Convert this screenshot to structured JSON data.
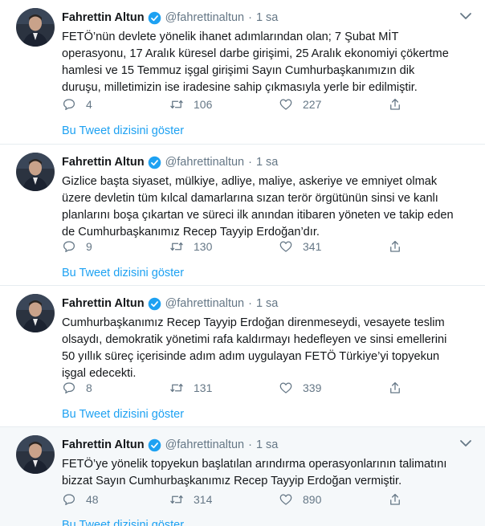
{
  "colors": {
    "accent": "#1da1f2",
    "secondary_text": "#657786",
    "divider": "#e6ecf0",
    "highlight_bg": "#f5f8fa"
  },
  "icons": [
    "verified-badge-icon",
    "chevron-down-icon",
    "reply-icon",
    "retweet-icon",
    "like-icon",
    "share-icon"
  ],
  "tweets": [
    {
      "name": "Fahrettin Altun",
      "handle": "@fahrettinaltun",
      "separator": "·",
      "time": "1 sa",
      "text": "FETÖ’nün devlete yönelik ihanet adımlarından olan;  7 Şubat MİT\noperasyonu, 17 Aralık küresel darbe girişimi, 25 Aralık ekonomiyi çökertme\nhamlesi ve 15 Temmuz işgal girişimi Sayın Cumhurbaşkanımızın dik\nduruşu, milletimizin ise iradesine sahip çıkmasıyla yerle bir edilmiştir.",
      "replies": "4",
      "retweets": "106",
      "likes": "227",
      "thread_link": "Bu Tweet dizisini göster"
    },
    {
      "name": "Fahrettin Altun",
      "handle": "@fahrettinaltun",
      "separator": "·",
      "time": "1 sa",
      "text": "Gizlice başta siyaset, mülkiye, adliye, maliye, askeriye ve emniyet olmak\nüzere devletin tüm kılcal damarlarına sızan terör örgütünün sinsi ve kanlı\nplanlarını boşa çıkartan ve süreci ilk anından itibaren yöneten ve takip eden\nde Cumhurbaşkanımız Recep Tayyip Erdoğan’dır.",
      "replies": "9",
      "retweets": "130",
      "likes": "341",
      "thread_link": "Bu Tweet dizisini göster"
    },
    {
      "name": "Fahrettin Altun",
      "handle": "@fahrettinaltun",
      "separator": "·",
      "time": "1 sa",
      "text": "Cumhurbaşkanımız Recep Tayyip Erdoğan direnmeseydi, vesayete teslim\nolsaydı, demokratik yönetimi rafa kaldırmayı hedefleyen ve sinsi emellerini\n50 yıllık süreç içerisinde adım adım uygulayan FETÖ Türkiye’yi topyekun\nişgal edecekti.",
      "replies": "8",
      "retweets": "131",
      "likes": "339",
      "thread_link": "Bu Tweet dizisini göster"
    },
    {
      "name": "Fahrettin Altun",
      "handle": "@fahrettinaltun",
      "separator": "·",
      "time": "1 sa",
      "text": "FETÖ’ye yönelik topyekun başlatılan arındırma operasyonlarının talimatını\nbizzat Sayın Cumhurbaşkanımız Recep Tayyip Erdoğan vermiştir.",
      "replies": "48",
      "retweets": "314",
      "likes": "890",
      "thread_link": "Bu Tweet dizisini göster"
    }
  ]
}
